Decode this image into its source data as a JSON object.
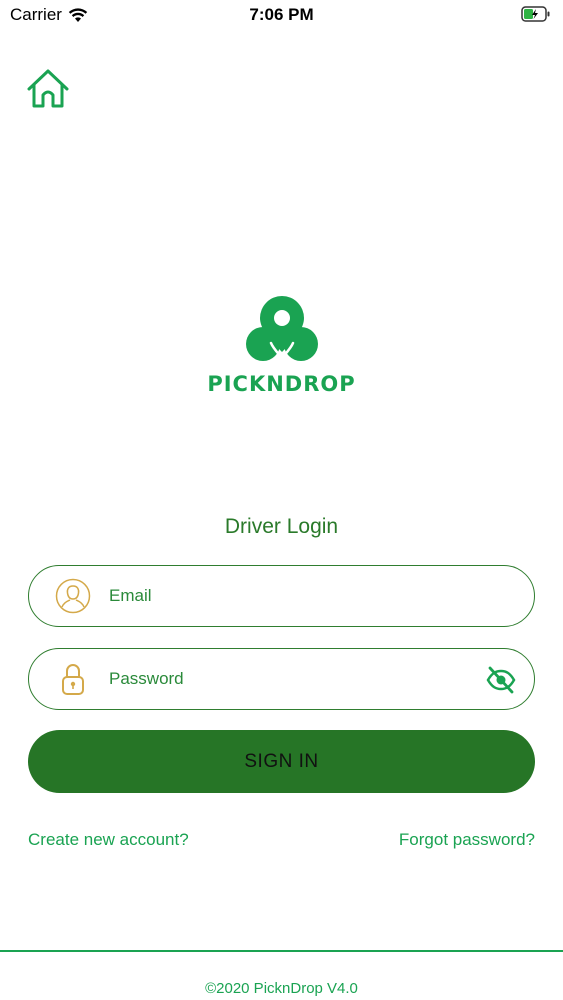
{
  "status_bar": {
    "carrier": "Carrier",
    "time": "7:06 PM"
  },
  "home": {
    "icon": "home-icon"
  },
  "logo": {
    "text": "PICKNDROP",
    "color": "#1aa352"
  },
  "form": {
    "title": "Driver Login",
    "email": {
      "placeholder": "Email",
      "value": "",
      "icon": "user-icon"
    },
    "password": {
      "placeholder": "Password",
      "value": "",
      "icon": "lock-icon",
      "toggle_icon": "eye-off-icon"
    },
    "signin_label": "SIGN IN"
  },
  "links": {
    "create_account": "Create new account?",
    "forgot_password": "Forgot password?"
  },
  "footer": {
    "text": "©2020 PicknDrop V4.0"
  },
  "colors": {
    "primary": "#267526",
    "accent": "#1aa352",
    "icon_gold": "#d4a94a"
  }
}
